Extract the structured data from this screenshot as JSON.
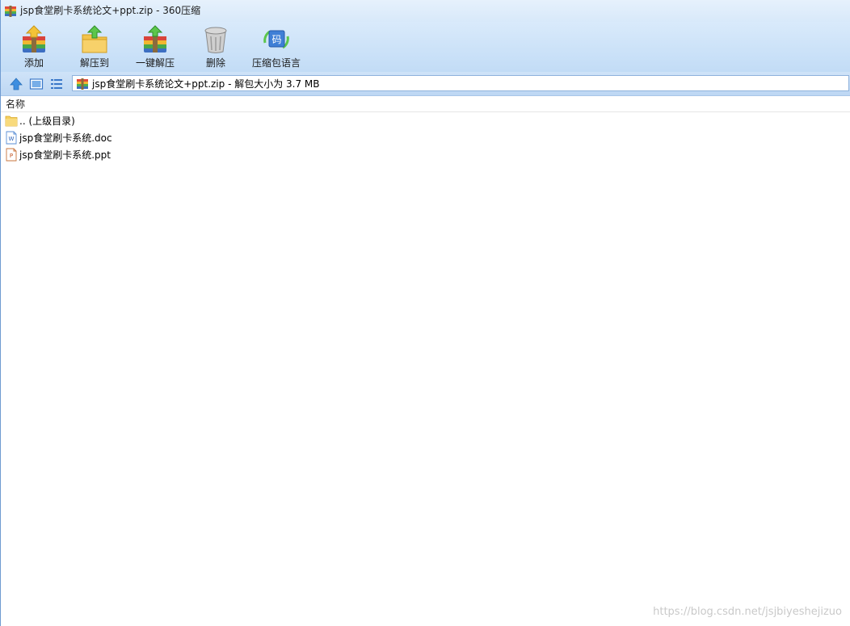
{
  "window": {
    "title": "jsp食堂刷卡系统论文+ppt.zip - 360压缩"
  },
  "toolbar": {
    "buttons": [
      {
        "label": "添加",
        "icon": "add-archive-icon"
      },
      {
        "label": "解压到",
        "icon": "extract-to-icon"
      },
      {
        "label": "一键解压",
        "icon": "one-click-extract-icon"
      },
      {
        "label": "删除",
        "icon": "trash-icon"
      },
      {
        "label": "压缩包语言",
        "icon": "archive-language-icon"
      }
    ]
  },
  "addressbar": {
    "path": "jsp食堂刷卡系统论文+ppt.zip - 解包大小为 3.7 MB"
  },
  "list": {
    "column_name": "名称",
    "items": [
      {
        "name": ".. (上级目录)",
        "icon": "folder-icon"
      },
      {
        "name": "jsp食堂刷卡系统.doc",
        "icon": "word-doc-icon"
      },
      {
        "name": "jsp食堂刷卡系统.ppt",
        "icon": "ppt-file-icon"
      }
    ]
  },
  "watermark": "https://blog.csdn.net/jsjbiyeshejizuo",
  "colors": {
    "toolbar_top": "#d9eafb",
    "toolbar_bottom": "#c2dcf6",
    "border_accent": "#6f9bd1"
  }
}
